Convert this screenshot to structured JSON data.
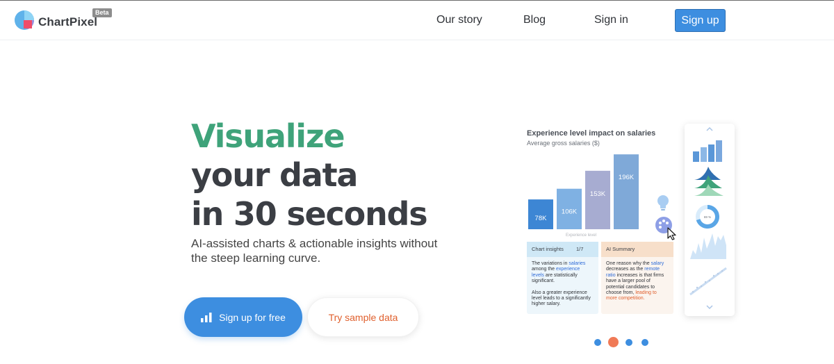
{
  "header": {
    "brand": "ChartPixel",
    "badge": "Beta",
    "nav": [
      "Our story",
      "Blog",
      "Sign in"
    ],
    "signup_label": "Sign up"
  },
  "hero": {
    "line1": "Visualize",
    "line2": "your data",
    "line3": "in 30 seconds",
    "subtitle": "AI-assisted charts & actionable insights without the steep learning curve.",
    "cta_primary": "Sign up for free",
    "cta_secondary": "Try sample data"
  },
  "preview": {
    "title": "Experience level impact on salaries",
    "subtitle": "Average gross salaries ($)",
    "x_label": "Experience level",
    "insights": {
      "header": "Chart insights",
      "count": "1/7",
      "p1_a": "The variations in ",
      "p1_b": "salaries",
      "p1_c": " among the ",
      "p1_d": "experience levels",
      "p1_e": " are statistically significant.",
      "p2": "Also a greater experience level leads to a significantly higher salary."
    },
    "ai": {
      "header": "AI Summary",
      "a": "One reason why the ",
      "b": "salary",
      "c": " decreases as the ",
      "d": "remote ratio",
      "e": " increases is that firms have a larger pool of potential candidates to choose from, ",
      "f": "leading to more competition."
    },
    "side_donut_label": "69 %"
  },
  "chart_data": {
    "type": "bar",
    "title": "Experience level impact on salaries",
    "subtitle": "Average gross salaries ($)",
    "xlabel": "Experience level",
    "ylabel": "",
    "categories": [
      "",
      "",
      "",
      ""
    ],
    "values": [
      78,
      106,
      153,
      196
    ],
    "value_labels": [
      "78K",
      "106K",
      "153K",
      "196K"
    ],
    "ylim": [
      0,
      200
    ],
    "colors": [
      "#3d86d4",
      "#7fb1e3",
      "#a7acd1",
      "#7fa9d8"
    ]
  },
  "carousel": {
    "count": 4,
    "active": 1
  },
  "colors": {
    "accent": "#3d8ee0",
    "green": "#3fa37a",
    "orange": "#e0602e"
  }
}
